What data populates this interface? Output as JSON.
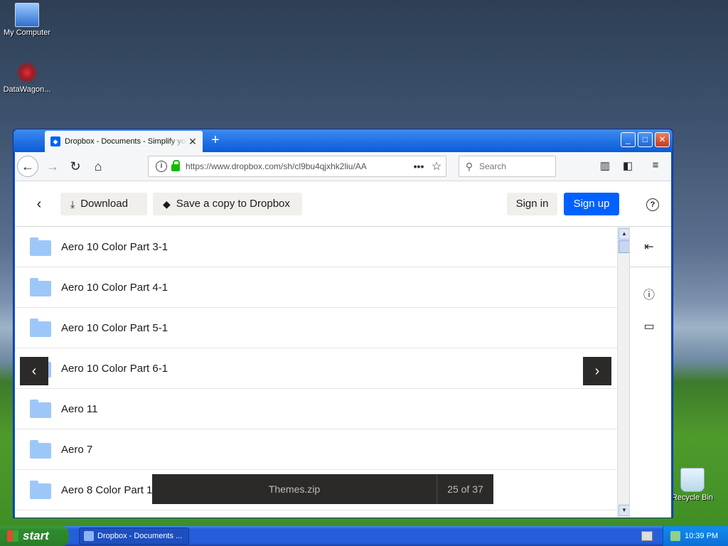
{
  "desktop": {
    "icons": [
      {
        "label": "My Computer"
      },
      {
        "label": "DataWagon..."
      },
      {
        "label": "Recycle Bin"
      }
    ]
  },
  "browser": {
    "tab_title": "Dropbox - Documents - Simplify your",
    "url": "https://www.dropbox.com/sh/cl9bu4qjxhk2liu/AA",
    "search_placeholder": "Search"
  },
  "dropbox": {
    "download_label": "Download",
    "save_label": "Save a copy to Dropbox",
    "signin_label": "Sign in",
    "signup_label": "Sign up",
    "items": [
      {
        "name": "Aero 10 Color Part 3-1"
      },
      {
        "name": "Aero 10 Color Part 4-1"
      },
      {
        "name": "Aero 10 Color Part 5-1"
      },
      {
        "name": "Aero 10 Color Part 6-1"
      },
      {
        "name": "Aero 11"
      },
      {
        "name": "Aero 7"
      },
      {
        "name": "Aero 8 Color Part 1"
      }
    ],
    "footer": {
      "filename": "Themes.zip",
      "position": "25 of 37"
    }
  },
  "taskbar": {
    "start_label": "start",
    "task_label": "Dropbox - Documents ...",
    "clock": "10:39 PM"
  }
}
